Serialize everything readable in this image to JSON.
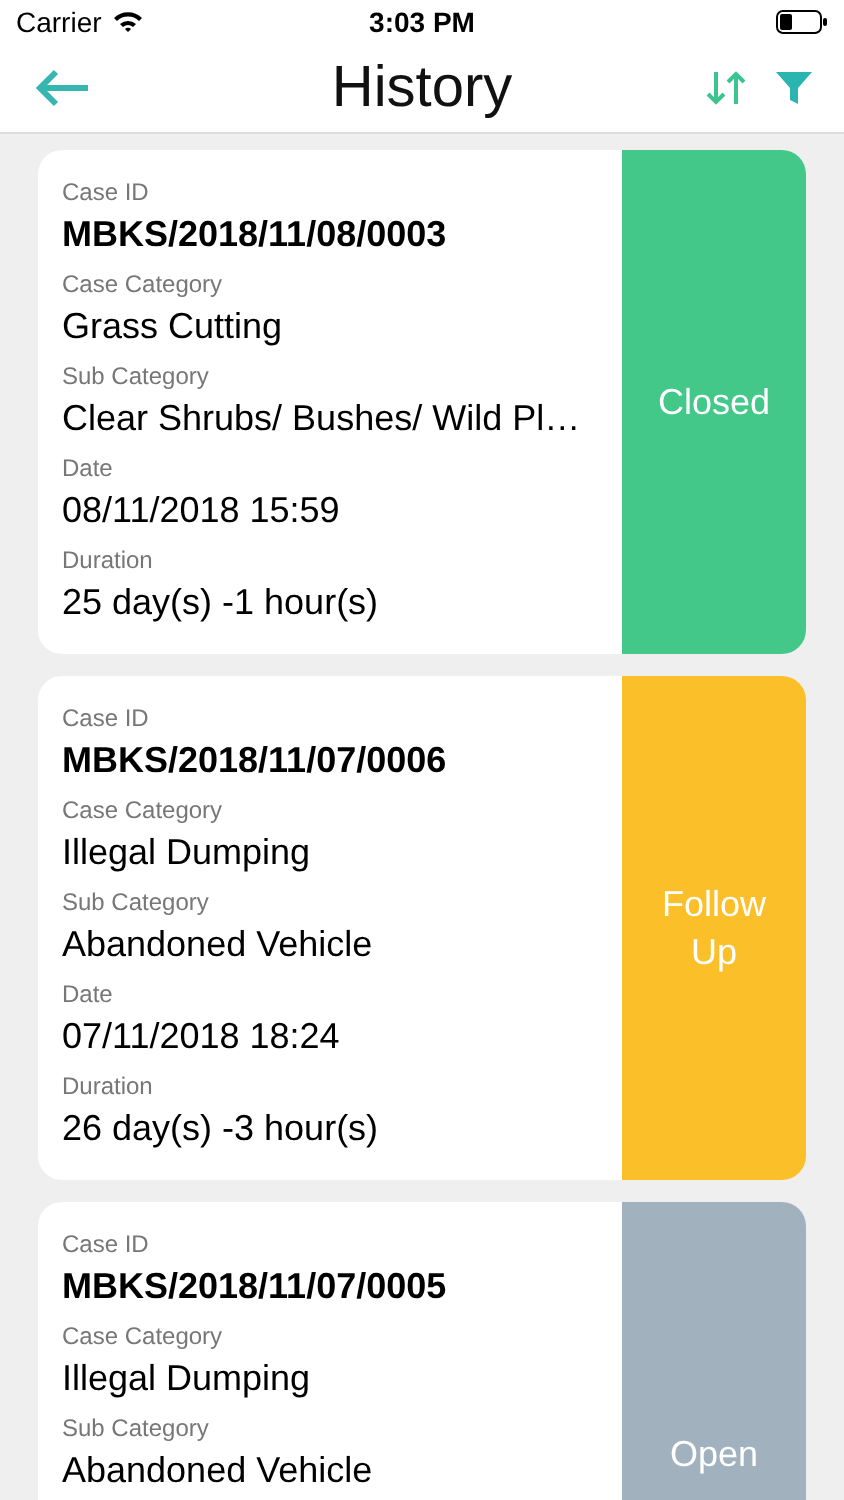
{
  "status_bar": {
    "carrier": "Carrier",
    "time": "3:03 PM"
  },
  "header": {
    "title": "History"
  },
  "cases": [
    {
      "fields": [
        {
          "label": "Case ID",
          "value": "MBKS/2018/11/08/0003",
          "kind": "id"
        },
        {
          "label": "Case Category",
          "value": "Grass Cutting",
          "kind": "text"
        },
        {
          "label": "Sub Category",
          "value": "Clear Shrubs/ Bushes/ Wild Pl…",
          "kind": "text"
        },
        {
          "label": "Date",
          "value": "08/11/2018 15:59",
          "kind": "text"
        },
        {
          "label": "Duration",
          "value": "25 day(s) -1 hour(s)",
          "kind": "text"
        }
      ],
      "status": {
        "label": "Closed",
        "kind": "closed"
      }
    },
    {
      "fields": [
        {
          "label": "Case ID",
          "value": "MBKS/2018/11/07/0006",
          "kind": "id"
        },
        {
          "label": "Case Category",
          "value": "Illegal Dumping",
          "kind": "text"
        },
        {
          "label": "Sub Category",
          "value": "Abandoned Vehicle",
          "kind": "text"
        },
        {
          "label": "Date",
          "value": "07/11/2018 18:24",
          "kind": "text"
        },
        {
          "label": "Duration",
          "value": "26 day(s) -3 hour(s)",
          "kind": "text"
        }
      ],
      "status": {
        "label": "Follow Up",
        "kind": "follow_up"
      }
    },
    {
      "fields": [
        {
          "label": "Case ID",
          "value": "MBKS/2018/11/07/0005",
          "kind": "id"
        },
        {
          "label": "Case Category",
          "value": "Illegal Dumping",
          "kind": "text"
        },
        {
          "label": "Sub Category",
          "value": "Abandoned Vehicle",
          "kind": "text"
        }
      ],
      "status": {
        "label": "Open",
        "kind": "open"
      }
    }
  ]
}
